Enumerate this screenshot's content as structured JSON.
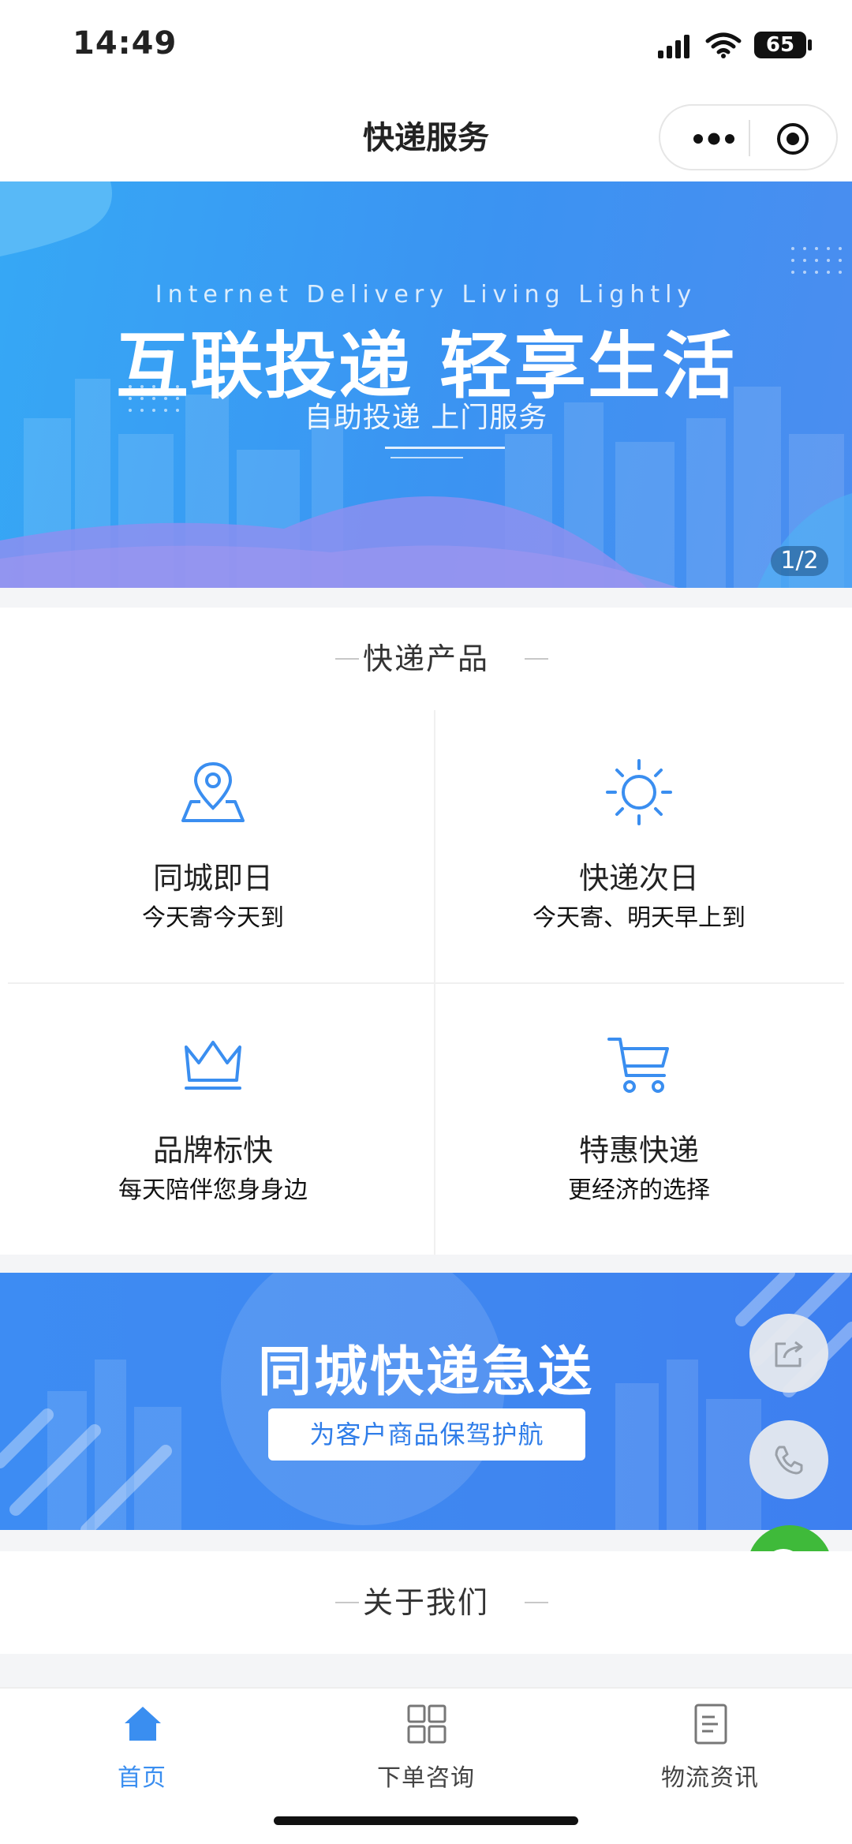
{
  "status_bar": {
    "time": "14:49",
    "battery": "65"
  },
  "nav": {
    "title": "快递服务"
  },
  "banner": {
    "subtitle_en": "Internet Delivery   Living Lightly",
    "title": "互联投递 轻享生活",
    "subtitle": "自助投递 上门服务",
    "pager": "1/2"
  },
  "products": {
    "title": "快递产品",
    "items": [
      {
        "title": "同城即日",
        "desc": "今天寄今天到",
        "icon": "location-pin-icon"
      },
      {
        "title": "快递次日",
        "desc": "今天寄、明天早上到",
        "icon": "sun-icon"
      },
      {
        "title": "品牌标快",
        "desc": "每天陪伴您身身边",
        "icon": "crown-icon"
      },
      {
        "title": "特惠快递",
        "desc": "更经济的选择",
        "icon": "cart-icon"
      }
    ]
  },
  "promo": {
    "title": "同城快递急送",
    "button": "为客户商品保驾护航"
  },
  "about": {
    "title": "关于我们"
  },
  "tabs": [
    {
      "label": "首页",
      "icon": "home-icon",
      "active": true
    },
    {
      "label": "下单咨询",
      "icon": "grid-icon",
      "active": false
    },
    {
      "label": "物流资讯",
      "icon": "document-icon",
      "active": false
    }
  ],
  "colors": {
    "accent": "#3a8ef0",
    "wechat": "#3fba3a",
    "tab_active": "#3a8ef0"
  }
}
